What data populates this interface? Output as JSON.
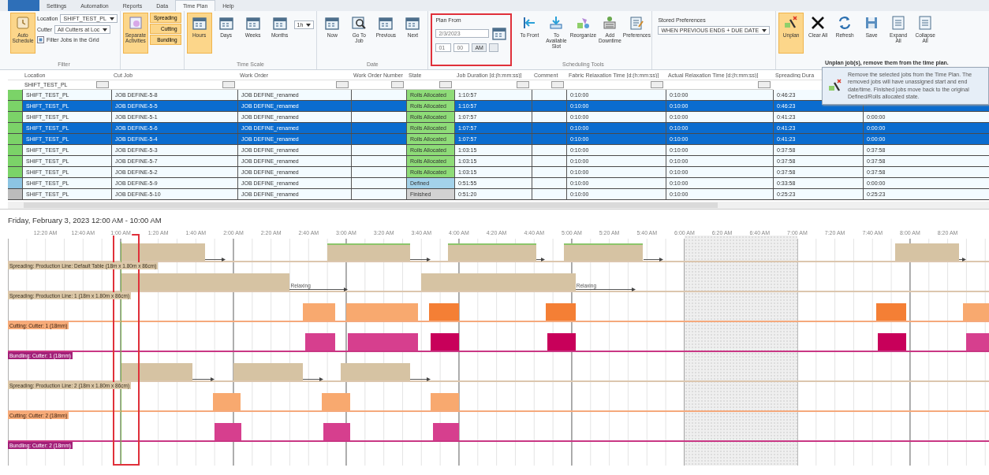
{
  "ribbon_tabs": [
    {
      "label": "Settings",
      "selected": false
    },
    {
      "label": "Automation",
      "selected": false
    },
    {
      "label": "Reports",
      "selected": false
    },
    {
      "label": "Data",
      "selected": false
    },
    {
      "label": "Time Plan",
      "selected": true
    },
    {
      "label": "Help",
      "selected": false
    }
  ],
  "ribbon": {
    "filter_group": {
      "schedule_button": {
        "label": "Auto Schedule",
        "selected": true
      },
      "location_label": "Location",
      "location_value": "SHIFT_TEST_PL",
      "cutter_label": "Cutter",
      "cutter_value": "All Cutters at Loc",
      "filter_checkbox": {
        "label": "Filter Jobs in the Grid",
        "checked": true
      },
      "caption": "Filter"
    },
    "activities_group": {
      "separate_button": {
        "label": "Separate Activities",
        "selected": true
      },
      "toggles": [
        {
          "label": "Spreading",
          "selected": true
        },
        {
          "label": "Cutting",
          "selected": true
        },
        {
          "label": "Bundling",
          "selected": true
        }
      ]
    },
    "time_scale_group": {
      "buttons": [
        {
          "label": "Hours",
          "selected": true
        },
        {
          "label": "Days",
          "selected": false
        },
        {
          "label": "Weeks",
          "selected": false
        },
        {
          "label": "Months",
          "selected": false
        }
      ],
      "interval": "1h",
      "caption": "Time Scale"
    },
    "date_group": {
      "buttons": [
        "Now",
        "Go To Job",
        "Previous",
        "Next"
      ],
      "caption": "Date"
    },
    "plan_from": {
      "label": "Plan From",
      "date": "2/3/2023",
      "hour": "01",
      "minute": "00",
      "ampm": "AM",
      "highlighted": true
    },
    "tools_group": {
      "buttons": [
        "To Front",
        "To Available Slot",
        "Reorganize",
        "Add Downtime",
        "Preferences"
      ],
      "caption": "Scheduling Tools"
    },
    "stored_preferences": {
      "label": "Stored Preferences",
      "value": "WHEN PREVIOUS ENDS + DUE DATE"
    },
    "actions": [
      {
        "label": "Unplan",
        "selected": true
      },
      {
        "label": "Clear All",
        "selected": false
      },
      {
        "label": "Refresh",
        "selected": false
      },
      {
        "label": "Save",
        "selected": false
      },
      {
        "label": "Expand All",
        "selected": false
      },
      {
        "label": "Collapse All",
        "selected": false
      }
    ]
  },
  "tooltip": {
    "title": "Unplan job(s), remove them from the time plan.",
    "text": "Remove the selected jobs from the Time Plan. The removed jobs will have unassigned start and end date/time. Finished jobs move back to the original Defined/Rolls allocated state."
  },
  "table": {
    "columns": [
      "Location",
      "Cut Job",
      "Work Order",
      "Work Order Number",
      "State",
      "Job Duration [d:(h:mm:ss)]",
      "Comment",
      "Fabric Relaxation Time [d:(h:mm:ss)]",
      "Actual Relaxation Time [d:(h:mm:ss)]",
      "Spreading Dura"
    ],
    "location_filter": "SHIFT_TEST_PL",
    "rows": [
      {
        "selected": false,
        "kind": "allocated",
        "cells": [
          "SHIFT_TEST_PL",
          "JOB DEFINE-5-8",
          "JOB DEFINE_renamed",
          null,
          "Rolls Allocated",
          "1:10:57",
          null,
          "0:10:00",
          "0:10:00",
          "0:46:23",
          null
        ]
      },
      {
        "selected": true,
        "kind": "allocated",
        "cells": [
          "SHIFT_TEST_PL",
          "JOB DEFINE-5-5",
          "JOB DEFINE_renamed",
          null,
          "Rolls Allocated",
          "1:10:57",
          null,
          "0:10:00",
          "0:10:00",
          "0:46:23",
          null
        ]
      },
      {
        "selected": false,
        "kind": "allocated",
        "cells": [
          "SHIFT_TEST_PL",
          "JOB DEFINE-5-1",
          "JOB DEFINE_renamed",
          null,
          "Rolls Allocated",
          "1:07:57",
          null,
          "0:10:00",
          "0:10:00",
          "0:41:23",
          "0:00:00"
        ]
      },
      {
        "selected": true,
        "kind": "allocated",
        "cells": [
          "SHIFT_TEST_PL",
          "JOB DEFINE-5-6",
          "JOB DEFINE_renamed",
          null,
          "Rolls Allocated",
          "1:07:57",
          null,
          "0:10:00",
          "0:10:00",
          "0:41:23",
          "0:00:00"
        ]
      },
      {
        "selected": true,
        "kind": "allocated",
        "cells": [
          "SHIFT_TEST_PL",
          "JOB DEFINE-5-4",
          "JOB DEFINE_renamed",
          null,
          "Rolls Allocated",
          "1:07:57",
          null,
          "0:10:00",
          "0:10:00",
          "0:41:23",
          "0:00:00"
        ]
      },
      {
        "selected": false,
        "kind": "allocated",
        "cells": [
          "SHIFT_TEST_PL",
          "JOB DEFINE-5-3",
          "JOB DEFINE_renamed",
          null,
          "Rolls Allocated",
          "1:03:15",
          null,
          "0:10:00",
          "0:10:00",
          "0:37:58",
          "0:37:58"
        ]
      },
      {
        "selected": false,
        "kind": "allocated",
        "cells": [
          "SHIFT_TEST_PL",
          "JOB DEFINE-5-7",
          "JOB DEFINE_renamed",
          null,
          "Rolls Allocated",
          "1:03:15",
          null,
          "0:10:00",
          "0:10:00",
          "0:37:58",
          "0:37:58"
        ]
      },
      {
        "selected": false,
        "kind": "allocated",
        "cells": [
          "SHIFT_TEST_PL",
          "JOB DEFINE-5-2",
          "JOB DEFINE_renamed",
          null,
          "Rolls Allocated",
          "1:03:15",
          null,
          "0:10:00",
          "0:10:00",
          "0:37:58",
          "0:37:58"
        ]
      },
      {
        "selected": false,
        "kind": "defined",
        "cells": [
          "SHIFT_TEST_PL",
          "JOB DEFINE-5-9",
          "JOB DEFINE_renamed",
          null,
          "Defined",
          "0:51:55",
          null,
          "0:10:00",
          "0:10:00",
          "0:33:58",
          "0:00:00"
        ]
      },
      {
        "selected": false,
        "kind": "finished",
        "cells": [
          "SHIFT_TEST_PL",
          "JOB DEFINE-5-10",
          "JOB DEFINE_renamed",
          null,
          "Finished",
          "0:51:20",
          null,
          "0:10:00",
          "0:10:00",
          "0:25:23",
          "0:25:23"
        ]
      }
    ]
  },
  "gantt": {
    "date_range": "Friday, February 3, 2023 12:00 AM - 10:00 AM",
    "time_labels": [
      "12:20 AM",
      "12:40 AM",
      "1:00 AM",
      "1:20 AM",
      "1:40 AM",
      "2:00 AM",
      "2:20 AM",
      "2:40 AM",
      "3:00 AM",
      "3:20 AM",
      "3:40 AM",
      "4:00 AM",
      "4:20 AM",
      "4:40 AM",
      "5:00 AM",
      "5:20 AM",
      "5:40 AM",
      "6:00 AM",
      "6:20 AM",
      "6:40 AM",
      "7:00 AM",
      "7:20 AM",
      "7:40 AM",
      "8:00 AM",
      "8:20 AM"
    ],
    "plan_marker": {
      "highlighted": true
    },
    "lanes": [
      {
        "kind": "spreading",
        "label": "Spreading: Production Line: Default Table (18m x 1.80m x 86cm)",
        "bars": [
          {
            "color": "#d6c3a3",
            "outlined": false
          },
          {
            "color": "#d6c3a3",
            "outlined": true
          },
          {
            "color": "#d6c3a3",
            "outlined": true
          },
          {
            "color": "#d6c3a3",
            "outlined": true
          },
          {
            "color": "#d6c3a3",
            "outlined": false
          }
        ]
      },
      {
        "kind": "spreading",
        "label": "Spreading: Production Line: 1 (18m x 1.80m x 86cm)",
        "bars": [
          {
            "color": "#d6c3a3",
            "outlined": false,
            "relax_label": "Relaxing"
          },
          {
            "color": "#d6c3a3",
            "outlined": false,
            "relax_label": "Relaxing"
          }
        ]
      },
      {
        "kind": "cutting",
        "label": "Cutting: Cutter: 1 (18mm)",
        "bars": [
          {
            "color": "#f8a96f"
          },
          {
            "color": "#f8a96f"
          },
          {
            "color": "#f47f35"
          },
          {
            "color": "#f47f35"
          },
          {
            "color": "#f47f35"
          },
          {
            "color": "#f8a96f"
          }
        ]
      },
      {
        "kind": "bundling",
        "label": "Bundling: Cutter: 1 (18mm)",
        "bars": [
          {
            "color": "#d63f8e"
          },
          {
            "color": "#d63f8e"
          },
          {
            "color": "#c8005a"
          },
          {
            "color": "#c8005a"
          },
          {
            "color": "#c8005a"
          },
          {
            "color": "#d63f8e"
          }
        ]
      },
      {
        "kind": "spreading",
        "label": "Spreading: Production Line: 2 (18m x 1.80m x 86cm)",
        "bars": [
          {
            "color": "#d6c3a3",
            "outlined": false
          },
          {
            "color": "#d6c3a3",
            "outlined": false
          },
          {
            "color": "#d6c3a3",
            "outlined": false
          }
        ]
      },
      {
        "kind": "cutting",
        "label": "Cutting: Cutter: 2 (18mm)",
        "bars": [
          {
            "color": "#f8a96f"
          },
          {
            "color": "#f8a96f"
          },
          {
            "color": "#f8a96f"
          }
        ]
      },
      {
        "kind": "bundling",
        "label": "Bundling: Cutter: 2 (18mm)",
        "bars": [
          {
            "color": "#d63f8e"
          },
          {
            "color": "#d63f8e"
          },
          {
            "color": "#d63f8e"
          }
        ]
      }
    ]
  }
}
